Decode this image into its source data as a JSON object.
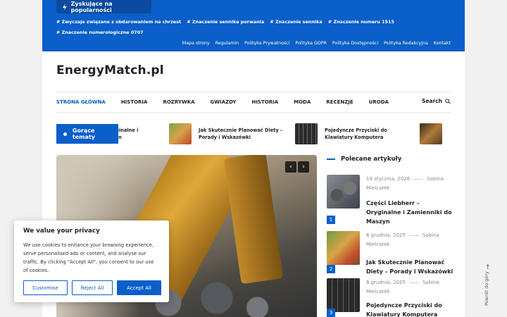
{
  "header": {
    "trending_label": "Zyskujące na popularności",
    "tags": [
      "# Zwyczaje związane z obdarowaniem na chrzest",
      "# Znaczenie sennika porwania",
      "# Znaczenie sennika",
      "# Znaczenie numeru 1515",
      "# Znaczenie numerologiczne 0707"
    ],
    "top_links": [
      "Mapa strony",
      "Regulamin",
      "Polityka Prywatności",
      "Polityka GDPR",
      "Polityka Dostępności",
      "Polityka Redakcyjna",
      "Kontakt"
    ]
  },
  "site": {
    "logo": "EnergyMatch.pl"
  },
  "nav": {
    "items": [
      "STRONA GŁÓWNA",
      "HISTORIA",
      "ROZRYWKA",
      "GWIAZDY",
      "HISTORIA",
      "MODA",
      "RECENZJE",
      "URODA"
    ],
    "search_label": "Search"
  },
  "ticker": {
    "label": "Gorące tematy",
    "items": [
      {
        "text": "yginalne i\nzyn"
      },
      {
        "text": "Jak Skutecznie Planować Diety – Porady i Wskazówki"
      },
      {
        "text": "Pojedyncze Przyciski do Klawiatury Komputera"
      }
    ]
  },
  "hero": {
    "prev_label": "‹",
    "next_label": "›"
  },
  "sidebar": {
    "title": "Polecane artykuły",
    "articles": [
      {
        "num": "1",
        "date": "19 stycznia, 2026",
        "author": "Sabina Mielcarek",
        "title": "Części Liebherr – Oryginalne i Zamienniki do Maszyn"
      },
      {
        "num": "2",
        "date": "6 grudnia, 2025",
        "author": "Sabina Mielcarek",
        "title": "Jak Skutecznie Planować Diety – Porady i Wskazówki"
      },
      {
        "num": "3",
        "date": "6 grudnia, 2025",
        "author": "Sabina Mielcarek",
        "title": "Pojedyncze Przyciski do Klawiatury Komputera"
      }
    ]
  },
  "cookie": {
    "title": "We value your privacy",
    "text": "We use cookies to enhance your browsing experience, serve personalised ads or content, and analyse our traffic. By clicking \"Accept All\", you consent to our use of cookies.",
    "customise": "Customise",
    "reject": "Reject All",
    "accept": "Accept All"
  },
  "back_to_top": "Powrót do góry",
  "colors": {
    "brand": "#0a5fc8"
  }
}
